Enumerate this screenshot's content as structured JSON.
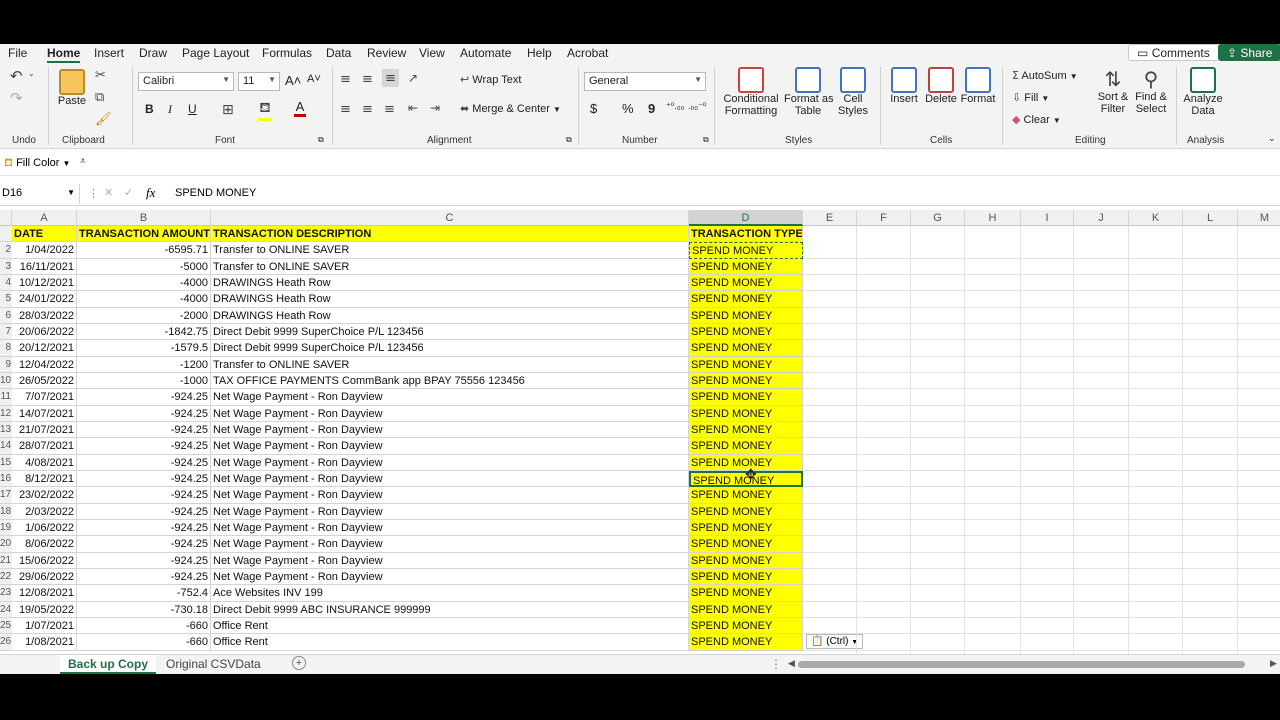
{
  "menu": {
    "items": [
      "File",
      "Home",
      "Insert",
      "Draw",
      "Page Layout",
      "Formulas",
      "Data",
      "Review",
      "View",
      "Automate",
      "Help",
      "Acrobat"
    ],
    "comments_label": "Comments",
    "share_label": "Share"
  },
  "ribbon": {
    "undo_label": "Undo",
    "clipboard": {
      "paste": "Paste",
      "label": "Clipboard"
    },
    "font": {
      "name": "Calibri",
      "size": "11",
      "label": "Font",
      "bold": "B",
      "italic": "I",
      "underline": "U"
    },
    "alignment": {
      "wrap_text": "Wrap Text",
      "merge_center": "Merge & Center",
      "label": "Alignment"
    },
    "number": {
      "format": "General",
      "label": "Number",
      "currency": "$",
      "percent": "%",
      "comma": "9"
    },
    "styles": {
      "conditional": "Conditional",
      "conditional2": "Formatting",
      "format_as": "Format as",
      "format_as2": "Table",
      "cell": "Cell",
      "cell2": "Styles",
      "label": "Styles"
    },
    "cells": {
      "insert": "Insert",
      "delete": "Delete",
      "format": "Format",
      "label": "Cells"
    },
    "editing": {
      "autosum": "AutoSum",
      "fill": "Fill",
      "clear": "Clear",
      "sort": "Sort &",
      "sort2": "Filter",
      "find": "Find &",
      "find2": "Select",
      "label": "Editing"
    },
    "analysis": {
      "analyze": "Analyze",
      "analyze2": "Data",
      "label": "Analysis"
    }
  },
  "quickbar": {
    "fill_color": "Fill Color"
  },
  "formula_bar": {
    "name_box": "D16",
    "fx": "fx",
    "value": "SPEND MONEY"
  },
  "columns": [
    "A",
    "B",
    "C",
    "D",
    "E",
    "F",
    "G",
    "H",
    "I",
    "J",
    "K",
    "L",
    "M"
  ],
  "selected_column": "D",
  "headers": {
    "a": "DATE",
    "b": "TRANSACTION AMOUNT",
    "c": "TRANSACTION DESCRIPTION",
    "d": "TRANSACTION TYPE"
  },
  "rows": [
    {
      "row": "2",
      "date": "1/04/2022",
      "amount": "-6595.71",
      "desc": "Transfer to ONLINE SAVER",
      "type": "SPEND MONEY"
    },
    {
      "row": "3",
      "date": "16/11/2021",
      "amount": "-5000",
      "desc": "Transfer to ONLINE SAVER",
      "type": "SPEND MONEY"
    },
    {
      "row": "4",
      "date": "10/12/2021",
      "amount": "-4000",
      "desc": "DRAWINGS Heath Row",
      "type": "SPEND MONEY"
    },
    {
      "row": "5",
      "date": "24/01/2022",
      "amount": "-4000",
      "desc": "DRAWINGS Heath Row",
      "type": "SPEND MONEY"
    },
    {
      "row": "6",
      "date": "28/03/2022",
      "amount": "-2000",
      "desc": "DRAWINGS Heath Row",
      "type": "SPEND MONEY"
    },
    {
      "row": "7",
      "date": "20/06/2022",
      "amount": "-1842.75",
      "desc": "Direct Debit 9999 SuperChoice P/L 123456",
      "type": "SPEND MONEY"
    },
    {
      "row": "8",
      "date": "20/12/2021",
      "amount": "-1579.5",
      "desc": "Direct Debit 9999 SuperChoice P/L 123456",
      "type": "SPEND MONEY"
    },
    {
      "row": "9",
      "date": "12/04/2022",
      "amount": "-1200",
      "desc": "Transfer to ONLINE SAVER",
      "type": "SPEND MONEY"
    },
    {
      "row": "10",
      "date": "26/05/2022",
      "amount": "-1000",
      "desc": "TAX OFFICE PAYMENTS CommBank app BPAY 75556 123456",
      "type": "SPEND MONEY"
    },
    {
      "row": "11",
      "date": "7/07/2021",
      "amount": "-924.25",
      "desc": "Net Wage Payment - Ron Dayview",
      "type": "SPEND MONEY"
    },
    {
      "row": "12",
      "date": "14/07/2021",
      "amount": "-924.25",
      "desc": "Net Wage Payment - Ron Dayview",
      "type": "SPEND MONEY"
    },
    {
      "row": "13",
      "date": "21/07/2021",
      "amount": "-924.25",
      "desc": "Net Wage Payment - Ron Dayview",
      "type": "SPEND MONEY"
    },
    {
      "row": "14",
      "date": "28/07/2021",
      "amount": "-924.25",
      "desc": "Net Wage Payment - Ron Dayview",
      "type": "SPEND MONEY"
    },
    {
      "row": "15",
      "date": "4/08/2021",
      "amount": "-924.25",
      "desc": "Net Wage Payment - Ron Dayview",
      "type": "SPEND MONEY"
    },
    {
      "row": "16",
      "date": "8/12/2021",
      "amount": "-924.25",
      "desc": "Net Wage Payment - Ron Dayview",
      "type": "SPEND MONEY"
    },
    {
      "row": "17",
      "date": "23/02/2022",
      "amount": "-924.25",
      "desc": "Net Wage Payment - Ron Dayview",
      "type": "SPEND MONEY"
    },
    {
      "row": "18",
      "date": "2/03/2022",
      "amount": "-924.25",
      "desc": "Net Wage Payment - Ron Dayview",
      "type": "SPEND MONEY"
    },
    {
      "row": "19",
      "date": "1/06/2022",
      "amount": "-924.25",
      "desc": "Net Wage Payment - Ron Dayview",
      "type": "SPEND MONEY"
    },
    {
      "row": "20",
      "date": "8/06/2022",
      "amount": "-924.25",
      "desc": "Net Wage Payment - Ron Dayview",
      "type": "SPEND MONEY"
    },
    {
      "row": "21",
      "date": "15/06/2022",
      "amount": "-924.25",
      "desc": "Net Wage Payment - Ron Dayview",
      "type": "SPEND MONEY"
    },
    {
      "row": "22",
      "date": "29/06/2022",
      "amount": "-924.25",
      "desc": "Net Wage Payment - Ron Dayview",
      "type": "SPEND MONEY"
    },
    {
      "row": "23",
      "date": "12/08/2021",
      "amount": "-752.4",
      "desc": "Ace Websites INV 199",
      "type": "SPEND MONEY"
    },
    {
      "row": "24",
      "date": "19/05/2022",
      "amount": "-730.18",
      "desc": "Direct Debit 9999 ABC INSURANCE 999999",
      "type": "SPEND MONEY"
    },
    {
      "row": "25",
      "date": "1/07/2021",
      "amount": "-660",
      "desc": "Office  Rent",
      "type": "SPEND MONEY"
    },
    {
      "row": "26",
      "date": "1/08/2021",
      "amount": "-660",
      "desc": "Office  Rent",
      "type": "SPEND MONEY"
    }
  ],
  "active_cell_row": "16",
  "paste_options": "(Ctrl)",
  "sheet_tabs": [
    "Back up Copy",
    "Original CSVData"
  ],
  "active_sheet": "Back up Copy",
  "colors": {
    "accent": "#1e7145",
    "highlight": "#ffff00"
  }
}
